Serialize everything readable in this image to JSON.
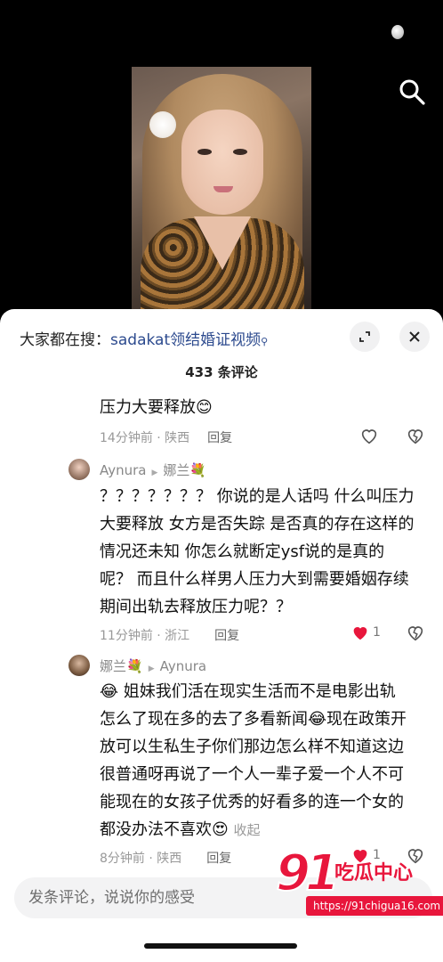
{
  "video": {},
  "header": {
    "search_prefix": "大家都在搜：",
    "search_keyword": "sadakat领结婚证视频",
    "comment_count": "433 条评论"
  },
  "comments": [
    {
      "text": "压力大要释放😊",
      "time": "14分钟前 · 陕西",
      "reply": "回复",
      "liked": false
    },
    {
      "author": "Aynura",
      "reply_to": "娜兰💐",
      "lines": [
        "？？？？？？？ 你说的是人话吗 什么叫压力",
        "大要释放 女方是否失踪 是否真的存在这样的",
        "情况还未知 你怎么就断定ysf说的是真的",
        "呢？ 而且什么样男人压力大到需要婚姻存续",
        "期间出轨去释放压力呢？？"
      ],
      "time": "11分钟前 · 浙江",
      "reply": "回复",
      "likes": "1",
      "liked": true
    },
    {
      "author": "娜兰💐",
      "reply_to": "Aynura",
      "lines": [
        "😂 姐妹我们活在现实生活而不是电影出轨",
        "怎么了现在多的去了多看新闻😂现在政策开",
        "放可以生私生子你们那边怎么样不知道这边",
        "很普通呀再说了一个人一辈子爱一个人不可",
        "能现在的女孩子优秀的好看多的连一个女的",
        "都没办法不喜欢😍"
      ],
      "collapse": "收起",
      "time": "8分钟前 · 陕西",
      "reply": "回复",
      "likes": "1",
      "liked": true
    }
  ],
  "input": {
    "placeholder": "发条评论，说说你的感受"
  },
  "watermark": {
    "number": "91",
    "title": "吃瓜中心",
    "url": "https://91chigua16.com"
  },
  "colors": {
    "like_red": "#e8163c",
    "keyword_blue": "#2c4a8e"
  }
}
